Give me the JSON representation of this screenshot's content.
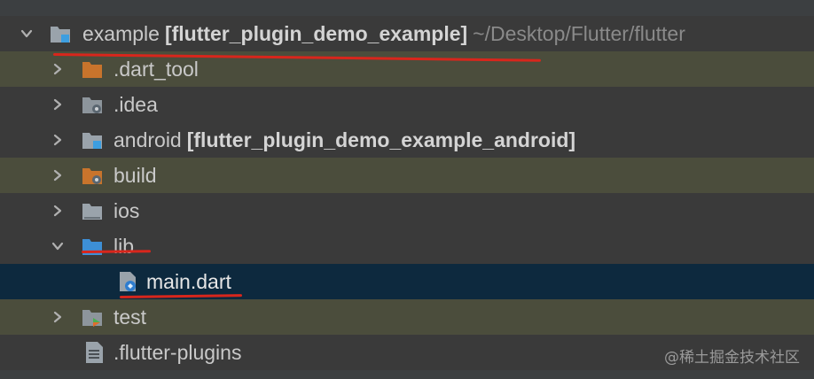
{
  "tree": {
    "root": {
      "name": "example",
      "module": "[flutter_plugin_demo_example]",
      "path": "~/Desktop/Flutter/flutter"
    },
    "items": [
      {
        "name": ".dart_tool",
        "icon": "folder-excluded-icon",
        "expandable": true
      },
      {
        "name": ".idea",
        "icon": "folder-config-icon",
        "expandable": true
      },
      {
        "name": "android",
        "module": "[flutter_plugin_demo_example_android]",
        "icon": "folder-module-icon",
        "expandable": true
      },
      {
        "name": "build",
        "icon": "folder-build-icon",
        "expandable": true
      },
      {
        "name": "ios",
        "icon": "folder-icon",
        "expandable": true
      },
      {
        "name": "lib",
        "icon": "folder-source-icon",
        "expanded": true
      },
      {
        "name": "main.dart",
        "icon": "dart-file-icon",
        "selected": true
      },
      {
        "name": "test",
        "icon": "folder-test-icon",
        "expandable": true
      },
      {
        "name": ".flutter-plugins",
        "icon": "text-file-icon"
      }
    ]
  },
  "watermark": "@稀土掘金技术社区",
  "colors": {
    "background": "#3c3f41",
    "selection": "#0d293e",
    "highlight": "#4b4d3c",
    "annotation": "#d8261c"
  }
}
